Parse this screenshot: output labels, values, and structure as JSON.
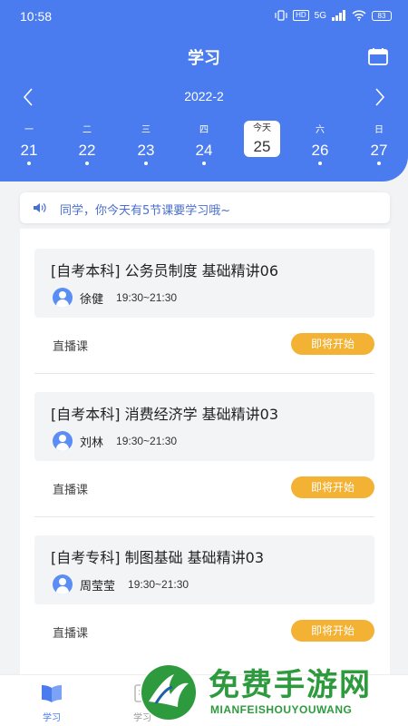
{
  "status_bar": {
    "time": "10:58",
    "hd": "HD",
    "signal": "5G",
    "battery": "83"
  },
  "header": {
    "title": "学习",
    "month": "2022-2"
  },
  "week": [
    {
      "weekday": "一",
      "day": "21"
    },
    {
      "weekday": "二",
      "day": "22"
    },
    {
      "weekday": "三",
      "day": "23"
    },
    {
      "weekday": "四",
      "day": "24"
    },
    {
      "weekday": "今天",
      "day": "25"
    },
    {
      "weekday": "六",
      "day": "26"
    },
    {
      "weekday": "日",
      "day": "27"
    }
  ],
  "notice": "同学，你今天有5节课要学习哦~",
  "courses": [
    {
      "title": "[自考本科] 公务员制度 基础精讲06",
      "teacher": "徐健",
      "time": "19:30~21:30",
      "type": "直播课",
      "button": "即将开始"
    },
    {
      "title": "[自考本科] 消费经济学 基础精讲03",
      "teacher": "刘林",
      "time": "19:30~21:30",
      "type": "直播课",
      "button": "即将开始"
    },
    {
      "title": "[自考专科] 制图基础 基础精讲03",
      "teacher": "周莹莹",
      "time": "19:30~21:30",
      "type": "直播课",
      "button": "即将开始"
    }
  ],
  "tabbar": [
    {
      "label": "学习"
    },
    {
      "label": "学习"
    }
  ],
  "watermark": {
    "title": "免费手游网",
    "subtitle": "MIANFEISHOUYOUWANG"
  },
  "colors": {
    "primary": "#4a7cf0",
    "button": "#f3b234",
    "watermark": "#2e9a3e"
  }
}
